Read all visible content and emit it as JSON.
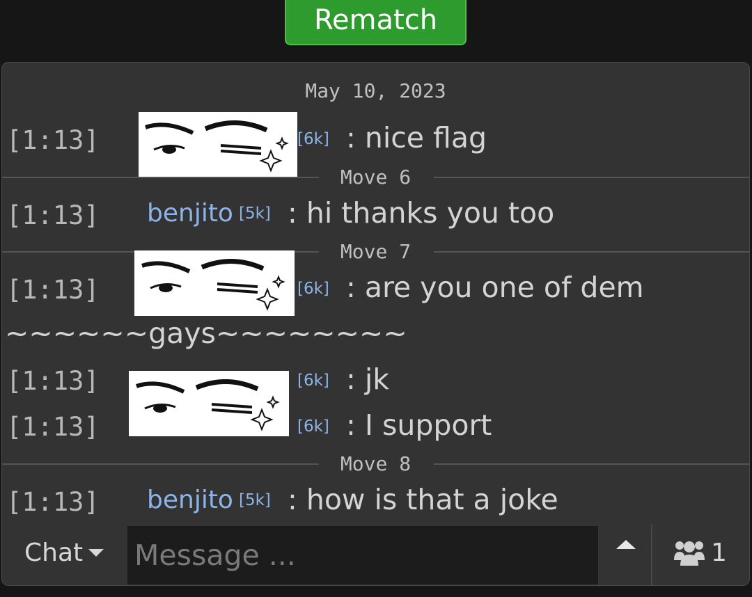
{
  "header": {
    "rematch_label": "Rematch"
  },
  "chat": {
    "date": "May 10, 2023",
    "messages": [
      {
        "time": "[1:13]",
        "user": "",
        "rank": "[6k]",
        "text": ": nice flag",
        "avatar_redacted": true
      },
      {
        "time": "[1:13]",
        "user": "benjito",
        "rank": "[5k]",
        "text": ": hi thanks you too"
      },
      {
        "time": "[1:13]",
        "user": "",
        "rank": "[6k]",
        "text": ": are you one of dem",
        "continuation": "~~~~~~gays~~~~~~~~",
        "avatar_redacted": true
      },
      {
        "time": "[1:13]",
        "user": "",
        "rank": "[6k]",
        "text": ": jk",
        "avatar_redacted": true
      },
      {
        "time": "[1:13]",
        "user": "",
        "rank": "[6k]",
        "text": ": I support",
        "avatar_redacted": true
      },
      {
        "time": "[1:13]",
        "user": "benjito",
        "rank": "[5k]",
        "text": ": how is that a joke"
      }
    ],
    "dividers": [
      "Move 6",
      "Move 7",
      "Move 8"
    ]
  },
  "footer": {
    "chat_menu_label": "Chat",
    "message_placeholder": "Message ...",
    "user_count": "1",
    "icons": {
      "dropdown": "caret-down-icon",
      "expand": "caret-up-icon",
      "users": "users-icon"
    }
  }
}
